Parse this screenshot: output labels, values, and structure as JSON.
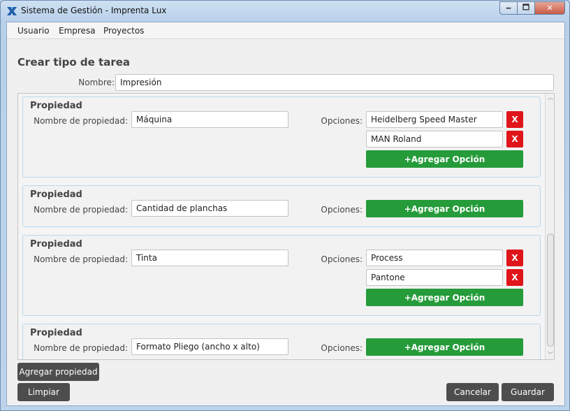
{
  "window": {
    "title": "Sistema de Gestión - Imprenta Lux",
    "minimize_glyph": "🗕",
    "maximize_glyph": "🗖",
    "close_glyph": "✕"
  },
  "menu": [
    {
      "label": "Usuario"
    },
    {
      "label": "Empresa"
    },
    {
      "label": "Proyectos"
    }
  ],
  "form": {
    "title": "Crear tipo de tarea",
    "name_label": "Nombre:",
    "name_value": "Impresión"
  },
  "property_labels": {
    "title": "Propiedad",
    "name_label": "Nombre de propiedad:",
    "options_label": "Opciones:",
    "add_option": "+Agregar Opción",
    "delete_glyph": "X"
  },
  "properties": [
    {
      "name": "Máquina",
      "options": [
        "Heidelberg Speed Master",
        "MAN Roland"
      ]
    },
    {
      "name": "Cantidad de planchas",
      "options": []
    },
    {
      "name": "Tinta",
      "options": [
        "Process",
        "Pantone"
      ]
    },
    {
      "name": "Formato Pliego (ancho x alto)",
      "options": []
    }
  ],
  "scrollbar": {
    "up_glyph": "︿",
    "down_glyph": "﹀"
  },
  "buttons": {
    "add_property": "Agregar propiedad",
    "clear": "Limpiar",
    "cancel": "Cancelar",
    "save": "Guardar"
  },
  "colors": {
    "add_button": "#259b3a",
    "delete_button": "#e0151a",
    "dark_button": "#4d4d4d",
    "card_border": "#b9d9ee"
  }
}
